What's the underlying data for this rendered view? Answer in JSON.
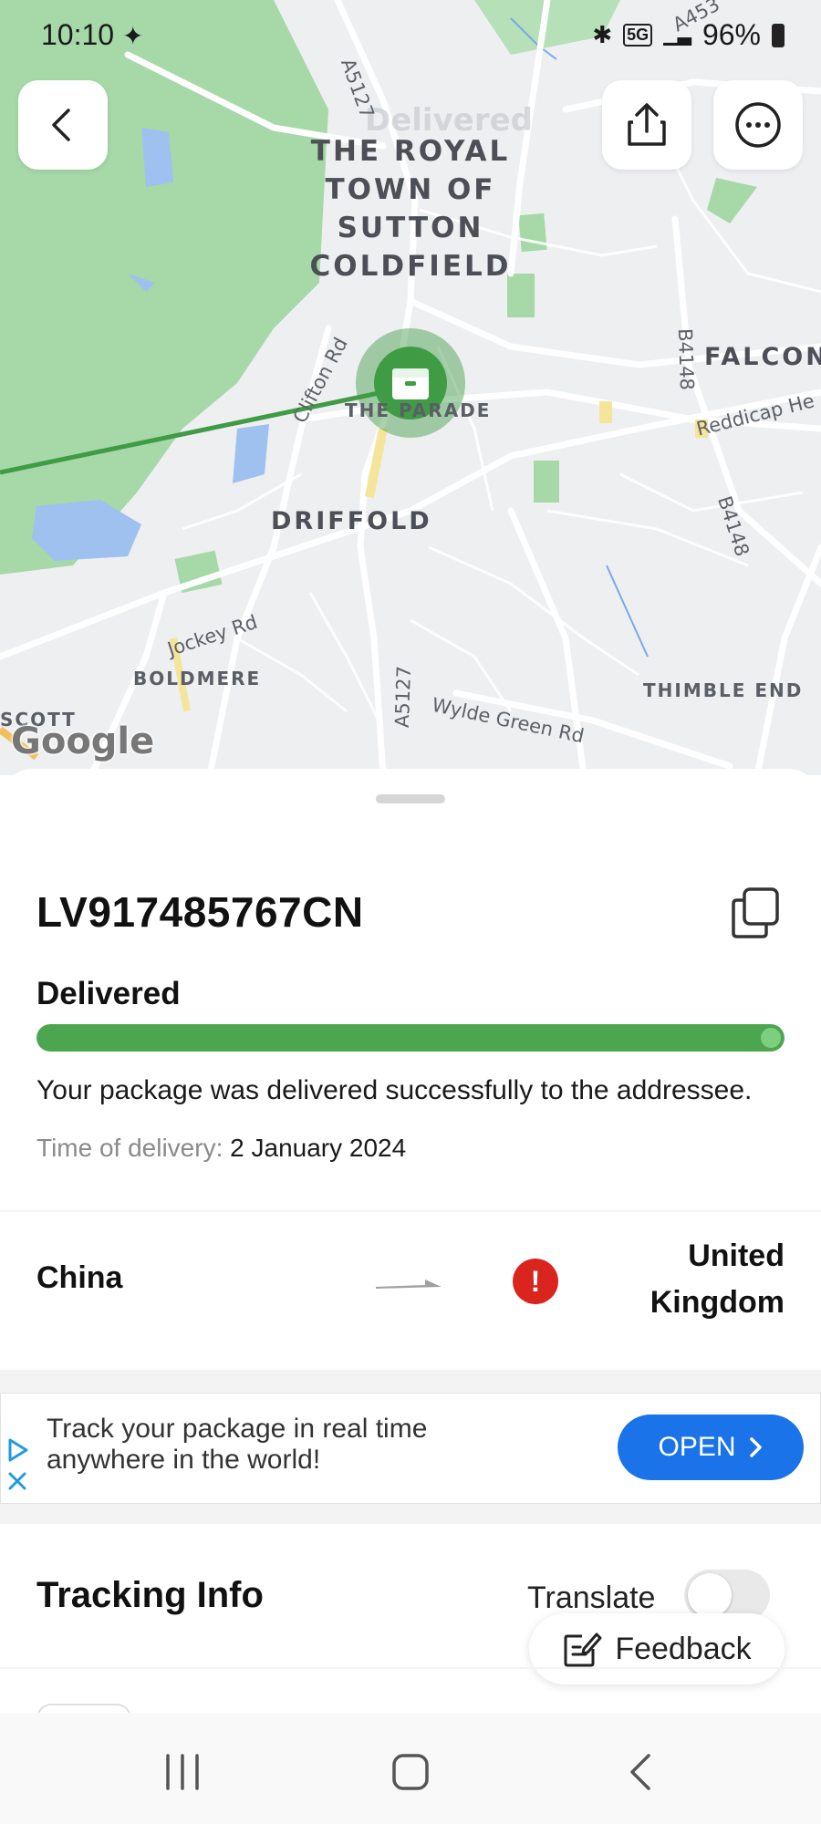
{
  "status_bar": {
    "time": "10:10",
    "battery": "96%",
    "network": "5G"
  },
  "map": {
    "delivered_overlay": "Delivered",
    "places": {
      "royal_town": "THE ROYAL\nTOWN OF\nSUTTON\nCOLDFIELD",
      "falcon": "FALCON",
      "driffold": "DRIFFOLD",
      "parade": "THE PARADE",
      "boldmere": "BOLDMERE",
      "thimble_end": "THIMBLE END",
      "scott": "SCOTT"
    },
    "roads": {
      "a5127_top": "A5127",
      "clifton": "Clifton Rd",
      "b4148_top": "B4148",
      "reddicap": "Reddicap He",
      "b4148_bottom": "B4148",
      "jockey": "Jockey Rd",
      "a5127_bottom": "A5127",
      "wylde_green": "Wylde Green Rd",
      "a453": "A453"
    },
    "attribution": "Google",
    "colors": {
      "park": "#a6d8a8",
      "water": "#9ec1ef",
      "route": "#3f9c45"
    }
  },
  "package": {
    "tracking_number": "LV917485767CN",
    "status": "Delivered",
    "progress": 1.0,
    "description": "Your package was delivered successfully to the addressee.",
    "time_label": "Time of delivery:",
    "time_value": "2 January 2024",
    "accent": "#4ca64f"
  },
  "route": {
    "origin": "China",
    "destination": "United Kingdom",
    "alert_icon": "!"
  },
  "ad": {
    "text": "Track your package in real time anywhere in the world!",
    "button": "OPEN",
    "button_color": "#1a73e8"
  },
  "tracking_info": {
    "title": "Tracking Info",
    "translate_label": "Translate",
    "translate_on": false,
    "feedback_label": "Feedback"
  },
  "icons": [
    "back-icon",
    "share-icon",
    "more-icon",
    "package-icon",
    "copy-icon",
    "arrow-right-icon",
    "alert-icon",
    "chevron-right-icon",
    "ad-choices-icon",
    "close-icon",
    "feedback-icon",
    "recents-icon",
    "home-icon",
    "nav-back-icon"
  ]
}
